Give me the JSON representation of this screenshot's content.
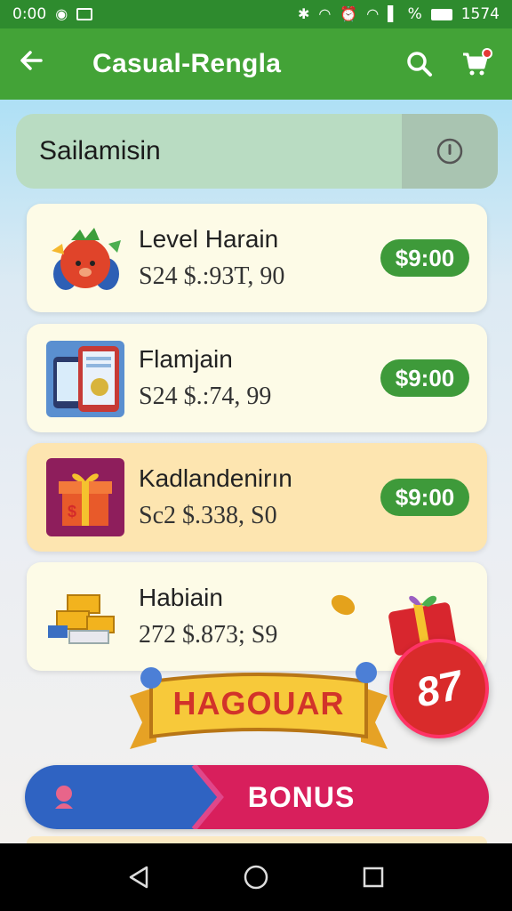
{
  "status_bar": {
    "time": "0:00",
    "battery_percent": "%",
    "clock_right": "1574"
  },
  "app_bar": {
    "title": "Casual-Rengla",
    "back_icon": "arrow-left-icon",
    "search_icon": "search-icon",
    "cart_icon": "cart-icon"
  },
  "section": {
    "label": "Sailamisin",
    "info_icon": "info-icon"
  },
  "items": [
    {
      "name": "Level Harain",
      "sub": "S24 $.:93T, 90",
      "price": "$9:00",
      "icon": "tomato-character-icon"
    },
    {
      "name": "Flamjain",
      "sub": "S24 $.:74, 99",
      "price": "$9:00",
      "icon": "phone-tablet-icon"
    },
    {
      "name": "Kadlandenirın",
      "sub": "Sc2 $.338, S0",
      "price": "$9:00",
      "icon": "gift-box-icon"
    },
    {
      "name": "Habiain",
      "sub": "272 $.873; S9",
      "price": "",
      "icon": "gold-bars-icon"
    }
  ],
  "banner": {
    "ribbon_text": "HAGOUAR",
    "badge_text": "87",
    "bonus_label": "BONUS"
  },
  "colors": {
    "app_bar": "#43a337",
    "price_button": "#3e9a3a",
    "bonus_left": "#2f63c2",
    "bonus_right": "#d81f5c",
    "badge": "#d92b2b"
  }
}
